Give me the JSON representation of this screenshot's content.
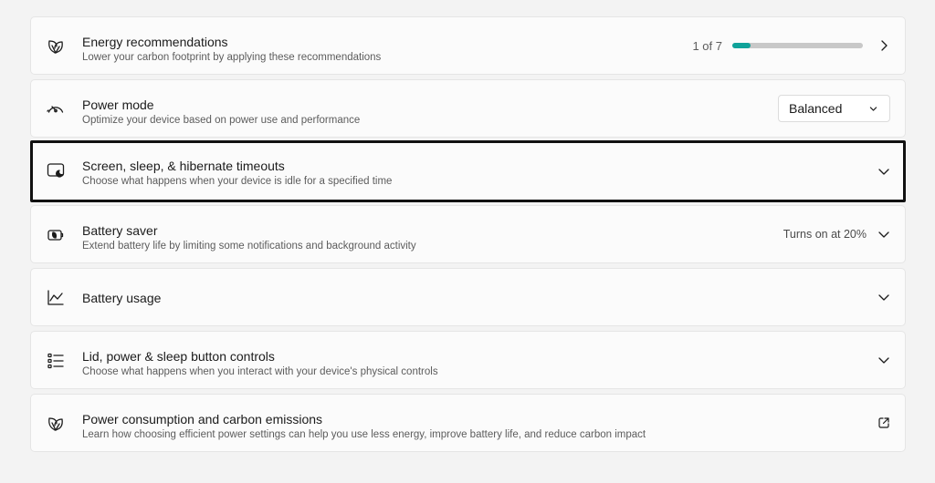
{
  "settings": [
    {
      "title": "Energy recommendations",
      "description": "Lower your carbon footprint by applying these recommendations",
      "icon": "leaf-icon",
      "pager": "1 of 7",
      "progress": 0.14
    },
    {
      "title": "Power mode",
      "description": "Optimize your device based on power use and performance",
      "icon": "gauge-icon",
      "dropdown_value": "Balanced"
    },
    {
      "title": "Screen, sleep, & hibernate timeouts",
      "description": "Choose what happens when your device is idle for a specified time",
      "icon": "screen-sleep-icon"
    },
    {
      "title": "Battery saver",
      "description": "Extend battery life by limiting some notifications and background activity",
      "icon": "battery-saver-icon",
      "status": "Turns on at 20%"
    },
    {
      "title": "Battery usage",
      "icon": "line-chart-icon"
    },
    {
      "title": "Lid, power & sleep button controls",
      "description": "Choose what happens when you interact with your device's physical controls",
      "icon": "list-icon"
    },
    {
      "title": "Power consumption and carbon emissions",
      "description": "Learn how choosing efficient power settings can help you use less energy, improve battery life, and reduce carbon impact",
      "icon": "leaf-icon"
    }
  ],
  "colors": {
    "accent": "#10a39a",
    "selection_border": "#111111"
  }
}
